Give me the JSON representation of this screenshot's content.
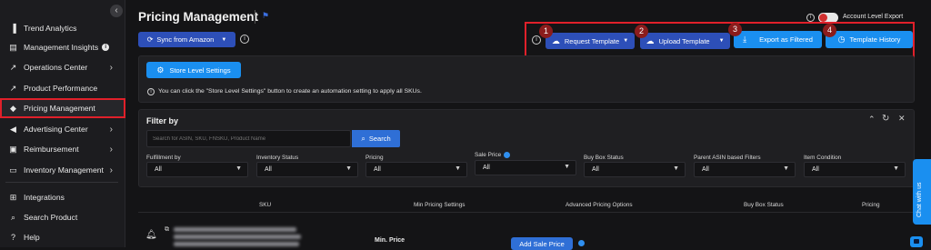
{
  "sidebar": {
    "collapse_glyph": "‹",
    "items": [
      {
        "label": "Trend Analytics",
        "icon": "trend-analytics-icon",
        "glyph": "▐",
        "chevron": false,
        "info": false
      },
      {
        "label": "Management Insights",
        "icon": "management-insights-icon",
        "glyph": "▤",
        "chevron": false,
        "info": true
      },
      {
        "label": "Operations Center",
        "icon": "operations-center-icon",
        "glyph": "↗",
        "chevron": true,
        "info": false
      },
      {
        "label": "Product Performance",
        "icon": "product-performance-icon",
        "glyph": "↗",
        "chevron": false,
        "info": false
      },
      {
        "label": "Pricing Management",
        "icon": "price-tag-icon",
        "glyph": "◆",
        "chevron": false,
        "info": false,
        "active": true
      },
      {
        "label": "Advertising Center",
        "icon": "megaphone-icon",
        "glyph": "◀",
        "chevron": true,
        "info": false
      },
      {
        "label": "Reimbursement",
        "icon": "reimbursement-icon",
        "glyph": "▣",
        "chevron": true,
        "info": false
      },
      {
        "label": "Inventory Management",
        "icon": "inventory-icon",
        "glyph": "▭",
        "chevron": true,
        "info": false
      },
      {
        "label": "Integrations",
        "icon": "integrations-icon",
        "glyph": "⊞",
        "chevron": false,
        "info": false
      },
      {
        "label": "Search Product",
        "icon": "search-icon",
        "glyph": "⌕",
        "chevron": false,
        "info": false
      },
      {
        "label": "Help",
        "icon": "help-icon",
        "glyph": "?",
        "chevron": false,
        "info": false
      }
    ]
  },
  "header": {
    "title": "Pricing Management",
    "bookmark_glyph": "⚑",
    "sync_label": "Sync from Amazon",
    "account_export_label": "Account Level Export",
    "info_glyph": "i"
  },
  "toolbar": {
    "request_template": "Request Template",
    "upload_template": "Upload Template",
    "export_filtered": "Export as Filtered",
    "template_history": "Template History",
    "badges": [
      "1",
      "2",
      "3",
      "4"
    ]
  },
  "store_settings": {
    "button_label": "Store Level Settings",
    "hint": "You can click the \"Store Level Settings\" button to create an automation setting to apply all SKUs."
  },
  "filter": {
    "title": "Filter by",
    "search_placeholder": "Search for ASIN, SKU, FNSKU, Product Name",
    "search_button": "Search",
    "fields": [
      {
        "label": "Fulfillment by",
        "value": "All"
      },
      {
        "label": "Inventory Status",
        "value": "All"
      },
      {
        "label": "Pricing",
        "value": "All"
      },
      {
        "label": "Sale Price",
        "value": "All"
      },
      {
        "label": "Buy Box Status",
        "value": "All"
      },
      {
        "label": "Parent ASIN based Filters",
        "value": "All"
      },
      {
        "label": "Item Condition",
        "value": "All"
      }
    ]
  },
  "table": {
    "headers": [
      "SKU",
      "Min Pricing Settings",
      "Advanced Pricing Options",
      "Buy Box Status",
      "Pricing"
    ],
    "row": {
      "min_price_label": "Min. Price",
      "add_sale_price": "Add Sale Price"
    }
  },
  "chat": {
    "label": "Chat with us"
  },
  "colors": {
    "background": "#141416",
    "sidebar": "#1c1c1f",
    "accent_blue": "#2f6fd6",
    "highlight_red": "#e0202a"
  }
}
